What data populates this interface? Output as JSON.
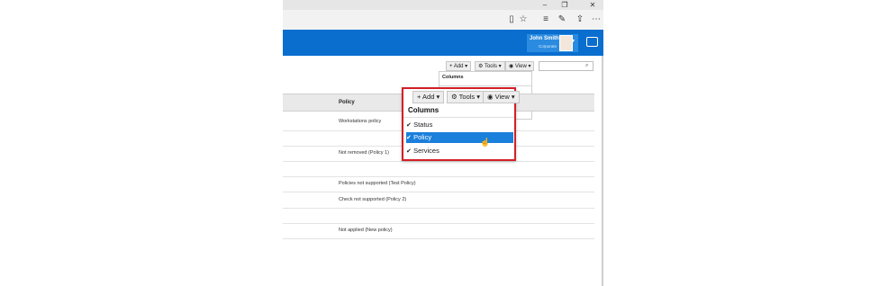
{
  "browser": {
    "window_controls": [
      "–",
      "❐",
      "✕"
    ],
    "toolbar_icons": [
      "reading-view-icon",
      "favorite-star-icon",
      "hub-icon",
      "notes-icon",
      "share-icon",
      "more-icon"
    ],
    "toolbar_glyphs": [
      "▯",
      "☆",
      "≡",
      "✎",
      "⇪",
      "⋯"
    ]
  },
  "header": {
    "user_name": "John Smith",
    "user_org": "Corporate",
    "accent": "#0a6ecf"
  },
  "toolbar": {
    "add_label": "+ Add ▾",
    "tools_label": "⚙ Tools ▾",
    "view_label": "◉ View ▾",
    "search_placeholder": ""
  },
  "small_dropdown": {
    "title": "Columns"
  },
  "table": {
    "column_header": "Policy",
    "rows": [
      "Workstations policy",
      "",
      "Not removed (Policy 1)",
      "",
      "Policies not supported (Test Policy)",
      "Check not supported (Policy 2)",
      "",
      "Not applied (New policy)"
    ]
  },
  "popup": {
    "add_label": "+ Add ▾",
    "tools_label": "⚙ Tools ▾",
    "view_label": "◉ View ▾",
    "title": "Columns",
    "items": [
      {
        "label": "Status",
        "checked": "✔"
      },
      {
        "label": "Policy",
        "checked": "✔"
      },
      {
        "label": "Services",
        "checked": "✔"
      }
    ],
    "highlight_color": "#1b7fdc",
    "border_color": "#d32027"
  }
}
